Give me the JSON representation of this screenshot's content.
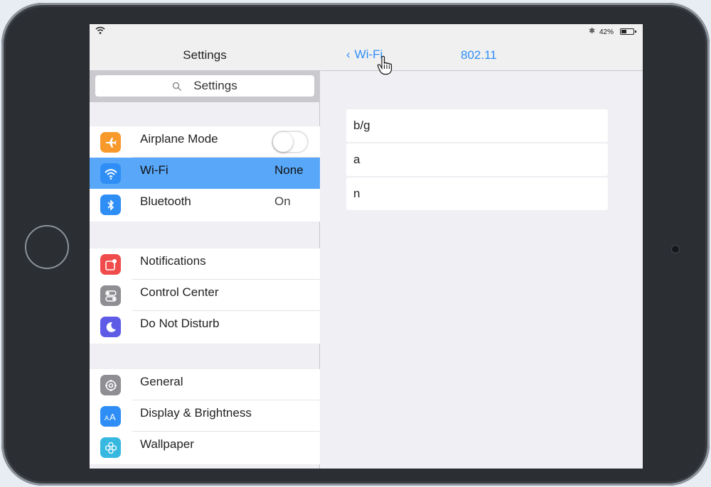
{
  "status_bar": {
    "battery_text": "42%",
    "battery_level": 0.42
  },
  "master": {
    "title": "Settings",
    "search_placeholder": "Settings",
    "groups": [
      {
        "items": [
          {
            "label": "Airplane Mode",
            "icon": "airplane-icon",
            "color": "#f79a2b",
            "toggle_on": false
          },
          {
            "label": "Wi-Fi",
            "value": "None",
            "icon": "wifi-icon",
            "color": "#2e8ef6",
            "selected": true
          },
          {
            "label": "Bluetooth",
            "value": "On",
            "icon": "bluetooth-icon",
            "color": "#2e8ef6"
          }
        ]
      },
      {
        "items": [
          {
            "label": "Notifications",
            "icon": "notifications-icon",
            "color": "#f04c4c"
          },
          {
            "label": "Control Center",
            "icon": "control-center-icon",
            "color": "#8e8e93"
          },
          {
            "label": "Do Not Disturb",
            "icon": "moon-icon",
            "color": "#5e5ce6"
          }
        ]
      },
      {
        "items": [
          {
            "label": "General",
            "icon": "gear-icon",
            "color": "#8e8e93"
          },
          {
            "label": "Display & Brightness",
            "icon": "display-brightness-icon",
            "color": "#2e8ef6"
          },
          {
            "label": "Wallpaper",
            "icon": "wallpaper-icon",
            "color": "#36b8e0"
          }
        ]
      }
    ]
  },
  "detail": {
    "back_label": "Wi-Fi",
    "title": "802.11",
    "options": [
      "b/g",
      "a",
      "n"
    ]
  },
  "colors": {
    "accent": "#2e8ef6",
    "selected_row": "#58a7f8"
  }
}
